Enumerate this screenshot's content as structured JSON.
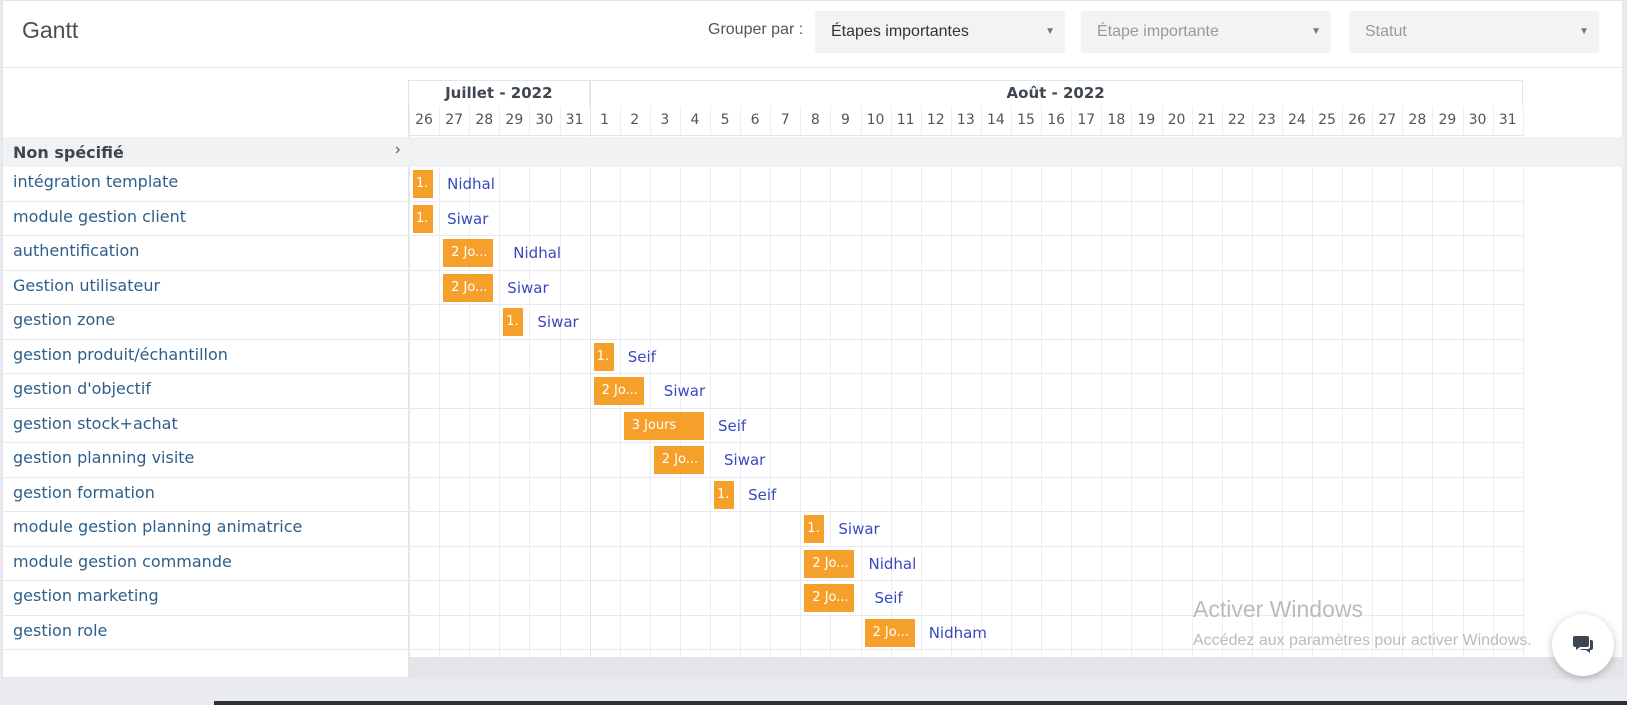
{
  "header": {
    "title": "Gantt",
    "group_by_label": "Grouper par :",
    "group_by_value": "Étapes importantes",
    "milestone_placeholder": "Étape importante",
    "status_placeholder": "Statut"
  },
  "group": {
    "name": "Non spécifié"
  },
  "months": [
    {
      "label": "Juillet - 2022",
      "start": 0,
      "span": 6
    },
    {
      "label": "Août - 2022",
      "start": 6,
      "span": 31
    }
  ],
  "days": [
    "26",
    "27",
    "28",
    "29",
    "30",
    "31",
    "1",
    "2",
    "3",
    "4",
    "5",
    "6",
    "7",
    "8",
    "9",
    "10",
    "11",
    "12",
    "13",
    "14",
    "15",
    "16",
    "17",
    "18",
    "19",
    "20",
    "21",
    "22",
    "23",
    "24",
    "25",
    "26",
    "27",
    "28",
    "29",
    "30",
    "31"
  ],
  "tasks": [
    {
      "name": "intégration template",
      "start": 0,
      "duration": 1,
      "bar_label": "1.",
      "assignee": "Nidhal"
    },
    {
      "name": "module gestion client",
      "start": 0,
      "duration": 1,
      "bar_label": "1.",
      "assignee": "Siwar"
    },
    {
      "name": "authentification",
      "start": 1,
      "duration": 2,
      "bar_label": "2 Jo...",
      "assignee": "Nidhal"
    },
    {
      "name": "Gestion utilisateur",
      "start": 1,
      "duration": 2,
      "bar_label": "2 Jo...",
      "assignee": "Siwar"
    },
    {
      "name": "gestion zone",
      "start": 3,
      "duration": 1,
      "bar_label": "1.",
      "assignee": "Siwar"
    },
    {
      "name": "gestion produit/échantillon",
      "start": 6,
      "duration": 1,
      "bar_label": "1.",
      "assignee": "Seif"
    },
    {
      "name": "gestion d'objectif",
      "start": 6,
      "duration": 2,
      "bar_label": "2 Jo...",
      "assignee": "Siwar"
    },
    {
      "name": "gestion stock+achat",
      "start": 7,
      "duration": 3,
      "bar_label": "3 Jours",
      "assignee": "Seif"
    },
    {
      "name": "gestion planning visite",
      "start": 8,
      "duration": 2,
      "bar_label": "2 Jo...",
      "assignee": "Siwar"
    },
    {
      "name": "gestion formation",
      "start": 10,
      "duration": 1,
      "bar_label": "1.",
      "assignee": "Seif"
    },
    {
      "name": "module gestion planning animatrice",
      "start": 13,
      "duration": 1,
      "bar_label": "1.",
      "assignee": "Siwar"
    },
    {
      "name": "module gestion commande",
      "start": 13,
      "duration": 2,
      "bar_label": "2 Jo...",
      "assignee": "Nidhal"
    },
    {
      "name": "gestion marketing",
      "start": 13,
      "duration": 2,
      "bar_label": "2 Jo...",
      "assignee": "Seif"
    },
    {
      "name": "gestion role",
      "start": 15,
      "duration": 2,
      "bar_label": "2 Jo...",
      "assignee": "Nidham"
    }
  ],
  "watermark": {
    "title": "Activer Windows",
    "subtitle": "Accédez aux paramètres pour activer Windows."
  },
  "colors": {
    "bar": "#f6a02c",
    "assignee": "#3a48c0",
    "task_label": "#2e5f8a"
  }
}
